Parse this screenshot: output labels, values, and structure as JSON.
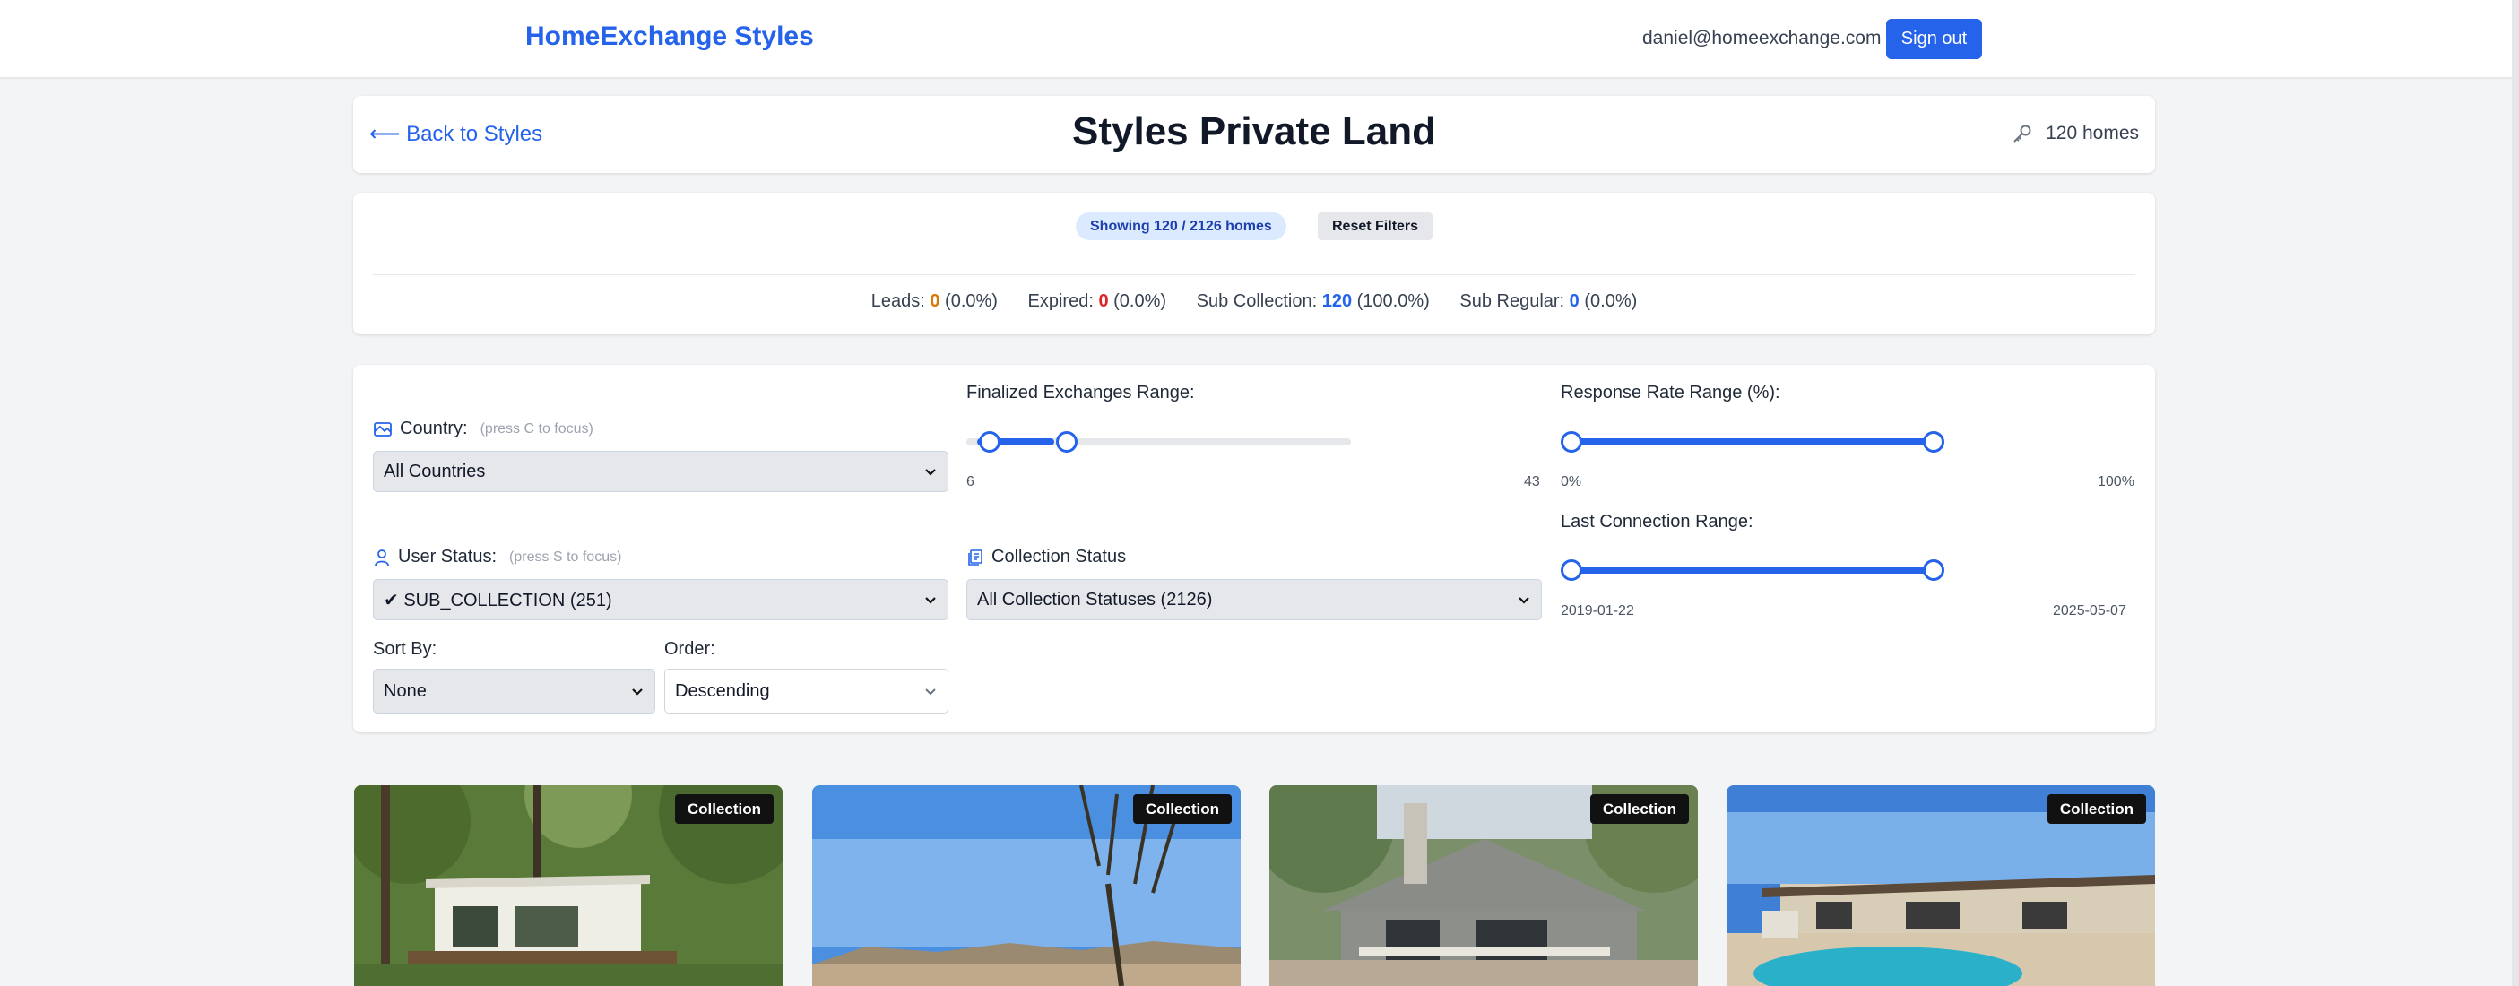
{
  "app": {
    "brand": "HomeExchange Styles",
    "user_email": "daniel@homeexchange.com",
    "signout_label": "Sign out"
  },
  "header": {
    "back_label": "⟵ Back to Styles",
    "title": "Styles Private Land",
    "homes_count": "120 homes",
    "icon": "key-icon"
  },
  "summary": {
    "showing_label": "Showing 120 / 2126 homes",
    "reset_label": "Reset Filters",
    "leads": {
      "label": "Leads:",
      "value": "0",
      "pct": "(0.0%)"
    },
    "expired": {
      "label": "Expired:",
      "value": "0",
      "pct": "(0.0%)"
    },
    "sub_collection": {
      "label": "Sub Collection:",
      "value": "120",
      "pct": "(100.0%)"
    },
    "sub_regular": {
      "label": "Sub Regular:",
      "value": "0",
      "pct": "(0.0%)"
    }
  },
  "filters": {
    "country": {
      "label": "Country:",
      "hint": "(press C to focus)",
      "value": "All Countries",
      "icon": "map-icon"
    },
    "user_status": {
      "label": "User Status:",
      "hint": "(press S to focus)",
      "value": "✔ SUB_COLLECTION (251)",
      "icon": "user-icon"
    },
    "sort_by": {
      "label": "Sort By:",
      "value": "None"
    },
    "order": {
      "label": "Order:",
      "value": "Descending"
    },
    "finalized": {
      "label": "Finalized Exchanges Range:",
      "min_label": "6",
      "max_label": "43",
      "range_low_fraction": 0,
      "range_high_fraction": 0.23
    },
    "collection_status": {
      "label": "Collection Status",
      "value": "All Collection Statuses (2126)",
      "icon": "collection-icon"
    },
    "response_rate": {
      "label": "Response Rate Range (%):",
      "min_label": "0%",
      "max_label": "100%",
      "range_low_fraction": 0,
      "range_high_fraction": 1
    },
    "last_connection": {
      "label": "Last Connection Range:",
      "min_label": "2019-01-22",
      "max_label": "2025-05-07",
      "range_low_fraction": 0,
      "range_high_fraction": 1
    }
  },
  "listings": [
    {
      "badge": "Collection"
    },
    {
      "badge": "Collection"
    },
    {
      "badge": "Collection"
    },
    {
      "badge": "Collection"
    }
  ],
  "colors": {
    "accent": "#2563eb",
    "orange": "#d97706",
    "red": "#dc2626"
  }
}
